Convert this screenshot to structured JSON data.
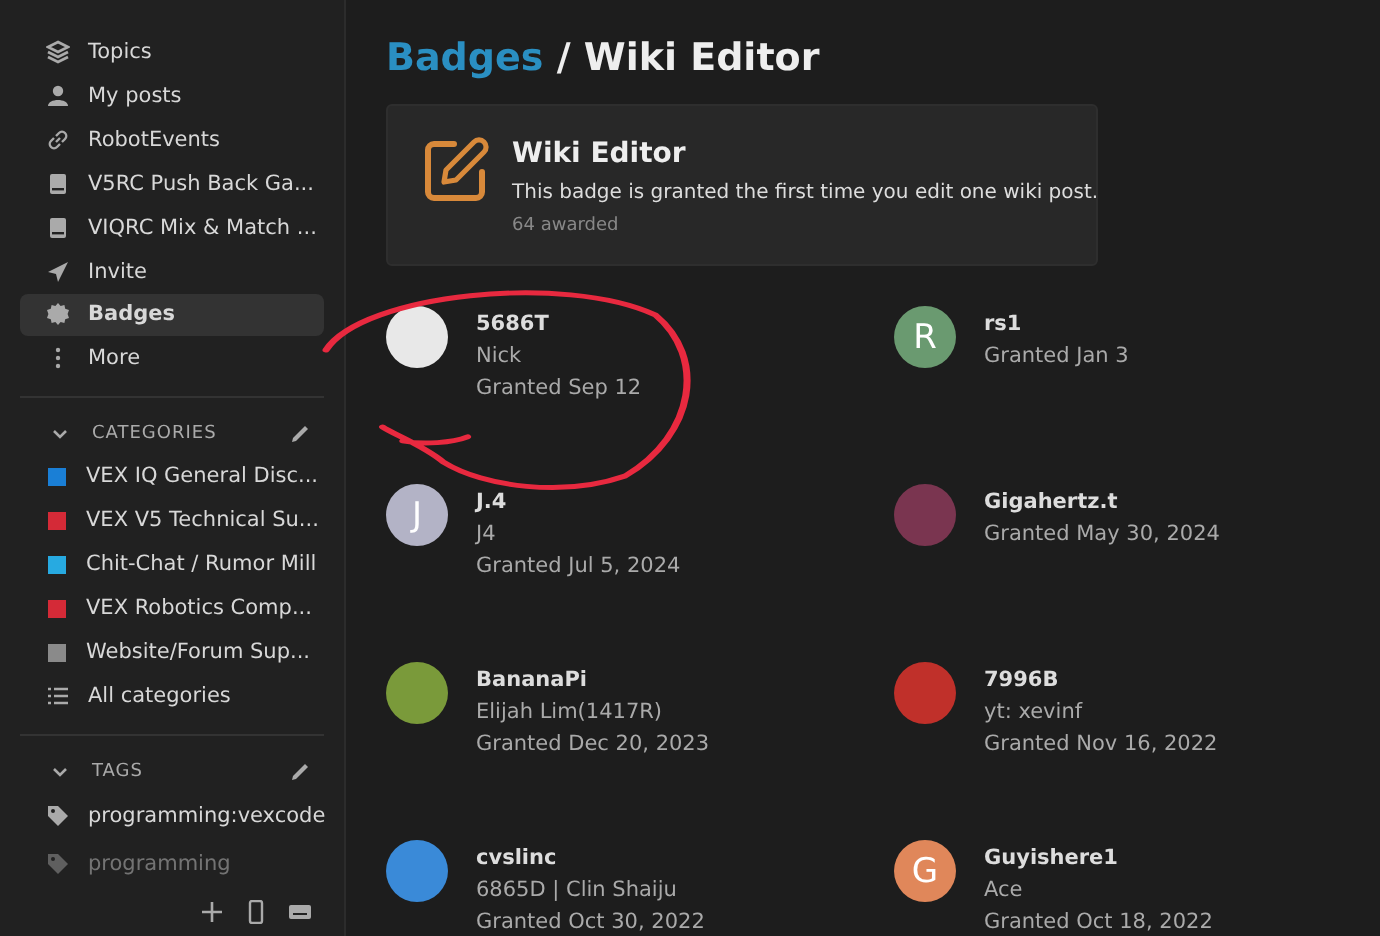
{
  "sidebar": {
    "nav": [
      {
        "label": "Topics",
        "selected": false
      },
      {
        "label": "My posts",
        "selected": false
      },
      {
        "label": "RobotEvents",
        "selected": false
      },
      {
        "label": "V5RC Push Back Ga...",
        "selected": false
      },
      {
        "label": "VIQRC Mix & Match ...",
        "selected": false
      },
      {
        "label": "Invite",
        "selected": false
      },
      {
        "label": "Badges",
        "selected": true
      },
      {
        "label": "More",
        "selected": false
      }
    ],
    "categories": {
      "title": "CATEGORIES",
      "items": [
        {
          "label": "VEX IQ General Disc...",
          "color": "#1a7fd6"
        },
        {
          "label": "VEX V5 Technical Su...",
          "color": "#d42a37"
        },
        {
          "label": "Chit-Chat / Rumor Mill",
          "color": "#27aae1"
        },
        {
          "label": "VEX Robotics Comp...",
          "color": "#d42a37"
        },
        {
          "label": "Website/Forum Sup...",
          "color": "#8a8a8a"
        }
      ],
      "all": "All categories"
    },
    "tags": {
      "title": "TAGS",
      "items": [
        "programming:vexcode",
        "programming"
      ]
    }
  },
  "page": {
    "breadcrumb_link": "Badges",
    "title": " / Wiki Editor"
  },
  "badge": {
    "name": "Wiki Editor",
    "description": "This badge is granted the first time you edit one wiki post.",
    "awarded": "64 awarded"
  },
  "users": [
    {
      "kind": "image",
      "color": "#e8e8e8",
      "username": "5686T",
      "name": "Nick",
      "granted": "Granted Sep 12"
    },
    {
      "kind": "letter",
      "letter": "R",
      "color": "#6a9a70",
      "username": "rs1",
      "granted": "Granted Jan 3"
    },
    {
      "kind": "letter",
      "letter": "J",
      "color": "#b3b3c6",
      "username": "J.4",
      "name": "J4",
      "granted": "Granted Jul 5, 2024"
    },
    {
      "kind": "image",
      "color": "#7a3550",
      "username": "Gigahertz.t",
      "granted": "Granted May 30, 2024"
    },
    {
      "kind": "image",
      "color": "#7a9a3a",
      "username": "BananaPi",
      "name": "Elijah Lim(1417R)",
      "granted": "Granted Dec 20, 2023"
    },
    {
      "kind": "image",
      "color": "#c0302a",
      "username": "7996B",
      "name": "yt: xevinf",
      "granted": "Granted Nov 16, 2022"
    },
    {
      "kind": "image",
      "color": "#3a8ad8",
      "username": "cvslinc",
      "name": "6865D | Clin Shaiju",
      "granted": "Granted Oct 30, 2022"
    },
    {
      "kind": "letter",
      "letter": "G",
      "color": "#e0875a",
      "username": "Guyishere1",
      "name": "Ace",
      "granted": "Granted Oct 18, 2022"
    }
  ]
}
